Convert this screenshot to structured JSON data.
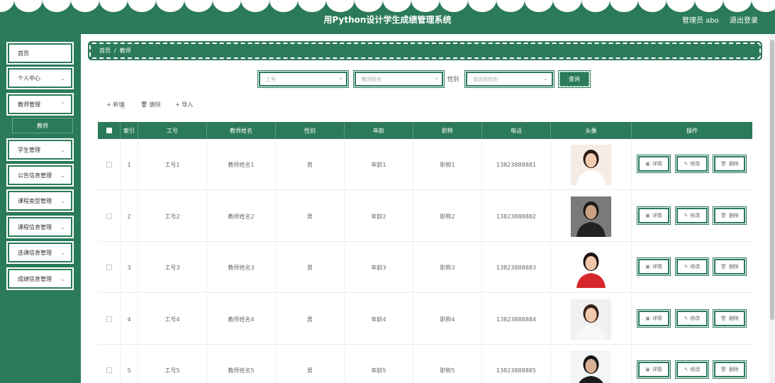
{
  "header": {
    "title": "用Python设计学生成绩管理系统",
    "user_label": "管理员 abo",
    "logout_label": "退出登录"
  },
  "sidebar": {
    "items": [
      {
        "label": "首页",
        "has_chevron": false
      },
      {
        "label": "个人中心",
        "has_chevron": true
      },
      {
        "label": "教师管理",
        "has_chevron": true
      },
      {
        "label": "学生管理",
        "has_chevron": true
      },
      {
        "label": "公告信息管理",
        "has_chevron": true
      },
      {
        "label": "课程类型管理",
        "has_chevron": true
      },
      {
        "label": "课程信息管理",
        "has_chevron": true
      },
      {
        "label": "选课信息管理",
        "has_chevron": true
      },
      {
        "label": "成绩信息管理",
        "has_chevron": true
      }
    ],
    "subitem": "教师"
  },
  "breadcrumb": {
    "home": "首页",
    "sep": "/",
    "current": "教师"
  },
  "search": {
    "id_placeholder": "工号",
    "name_placeholder": "教师姓名",
    "gender_label": "性别",
    "gender_placeholder": "请选择性别",
    "query_label": "查询"
  },
  "actions": {
    "add": "新增",
    "delete": "删除",
    "import": "导入"
  },
  "table": {
    "columns": [
      "索引",
      "工号",
      "教师姓名",
      "性别",
      "年龄",
      "职称",
      "电话",
      "头像",
      "操作"
    ],
    "rows": [
      {
        "index": "1",
        "id": "工号1",
        "name": "教师姓名1",
        "gender": "男",
        "age": "年龄1",
        "title": "职称1",
        "phone": "13823888881"
      },
      {
        "index": "2",
        "id": "工号2",
        "name": "教师姓名2",
        "gender": "男",
        "age": "年龄2",
        "title": "职称2",
        "phone": "13823888882"
      },
      {
        "index": "3",
        "id": "工号3",
        "name": "教师姓名3",
        "gender": "男",
        "age": "年龄3",
        "title": "职称3",
        "phone": "13823888883"
      },
      {
        "index": "4",
        "id": "工号4",
        "name": "教师姓名4",
        "gender": "男",
        "age": "年龄4",
        "title": "职称4",
        "phone": "13823888884"
      },
      {
        "index": "5",
        "id": "工号5",
        "name": "教师姓名5",
        "gender": "男",
        "age": "年龄5",
        "title": "职称5",
        "phone": "13823888885"
      }
    ],
    "row_actions": {
      "detail": "详情",
      "edit": "修改",
      "delete": "删除"
    }
  },
  "colors": {
    "theme": "#2b7a5a",
    "white": "#ffffff"
  }
}
